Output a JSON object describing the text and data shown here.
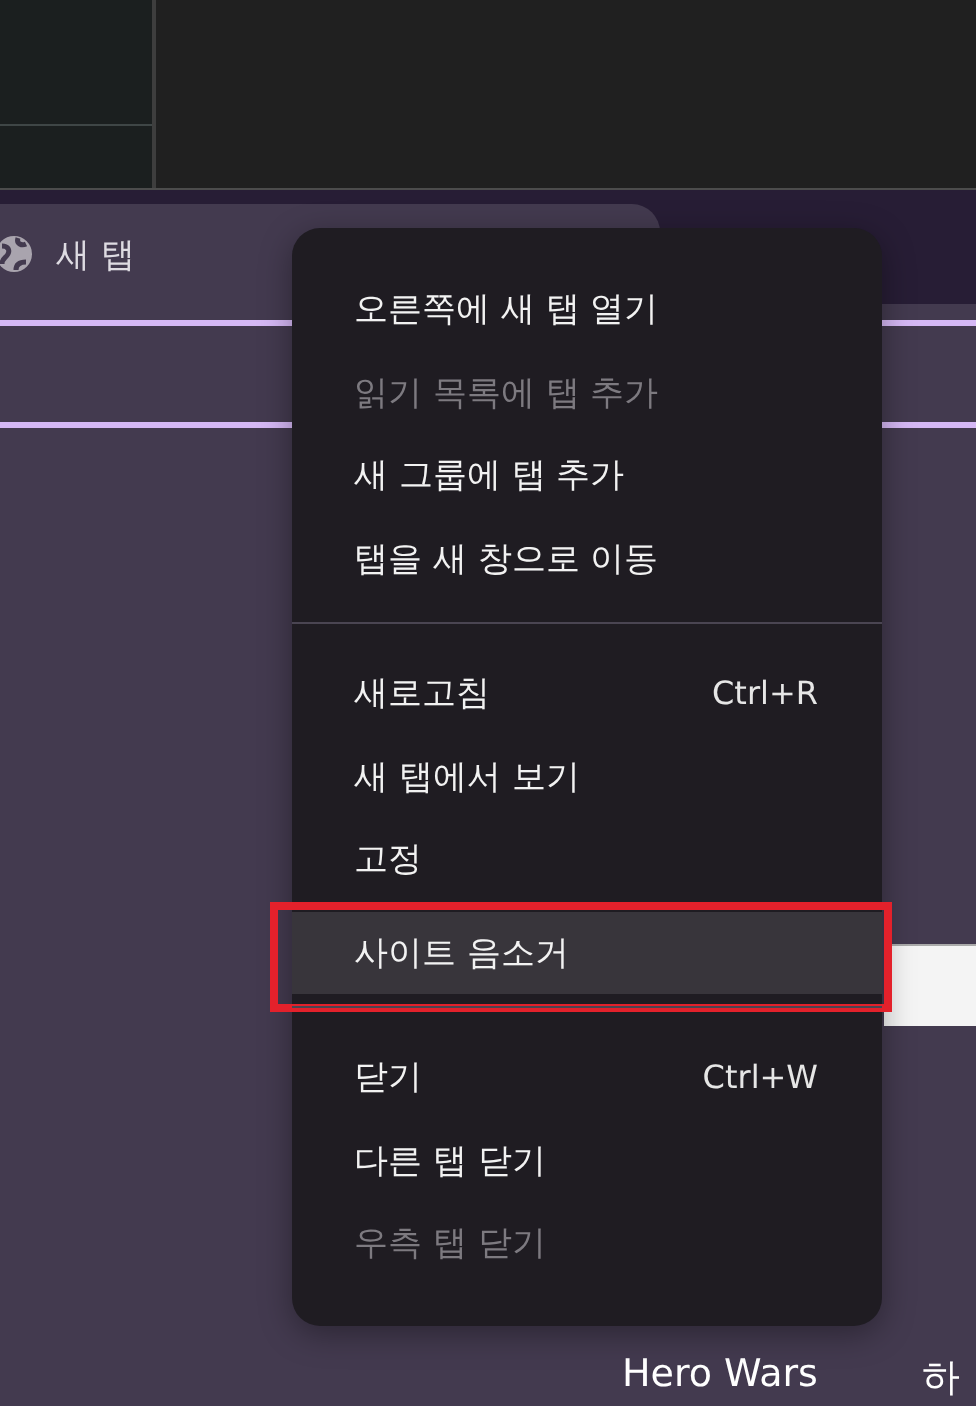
{
  "tab": {
    "title": "새 탭"
  },
  "context_menu": {
    "groups": [
      [
        {
          "label": "오른쪽에 새 탭 열기",
          "disabled": false,
          "hovered": false,
          "outlined": false
        },
        {
          "label": "읽기 목록에 탭 추가",
          "disabled": true,
          "hovered": false,
          "outlined": false
        },
        {
          "label": "새 그룹에 탭 추가",
          "disabled": false,
          "hovered": false,
          "outlined": false
        },
        {
          "label": "탭을 새 창으로 이동",
          "disabled": false,
          "hovered": false,
          "outlined": false
        }
      ],
      [
        {
          "label": "새로고침",
          "shortcut": "Ctrl+R",
          "disabled": false,
          "hovered": false,
          "outlined": false
        },
        {
          "label": "새 탭에서 보기",
          "disabled": false,
          "hovered": false,
          "outlined": false
        },
        {
          "label": "고정",
          "disabled": false,
          "hovered": false,
          "outlined": false
        },
        {
          "label": "사이트 음소거",
          "disabled": false,
          "hovered": true,
          "outlined": true
        }
      ],
      [
        {
          "label": "닫기",
          "shortcut": "Ctrl+W",
          "disabled": false,
          "hovered": false,
          "outlined": false
        },
        {
          "label": "다른 탭 닫기",
          "disabled": false,
          "hovered": false,
          "outlined": false
        },
        {
          "label": "우측 탭 닫기",
          "disabled": true,
          "hovered": false,
          "outlined": false
        }
      ]
    ]
  },
  "bottom_links": [
    "Hero Wars",
    "하"
  ]
}
